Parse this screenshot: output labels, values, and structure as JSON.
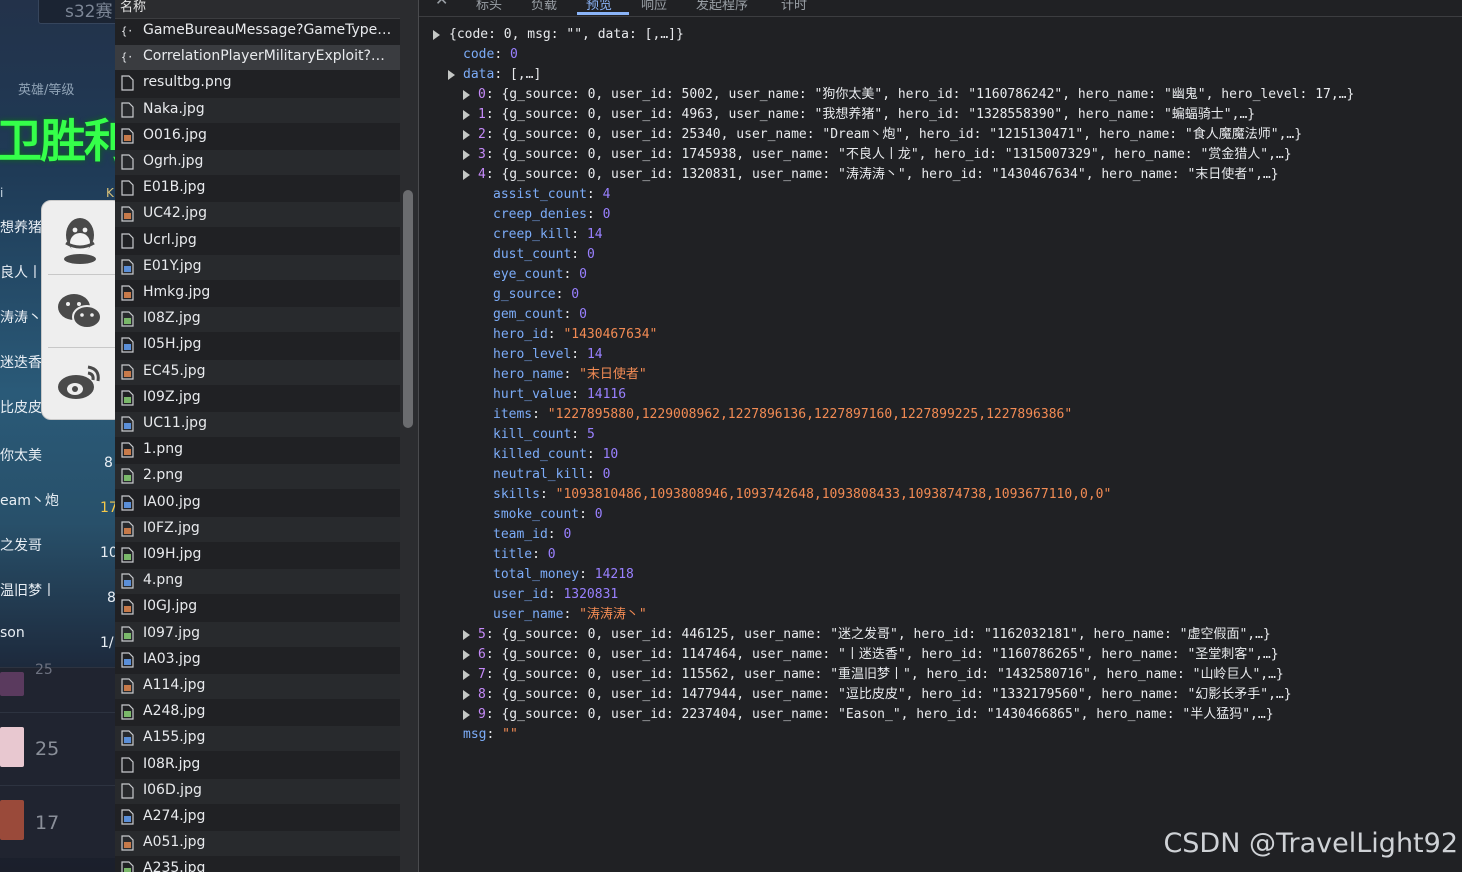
{
  "game": {
    "search_text": "s32赛",
    "header": "英雄/等级",
    "result": "卫胜利",
    "names": [
      "想养猪",
      "良人丨",
      "涛涛丶",
      "迷迭香",
      "比皮皮",
      "你太美",
      "eam丶炮",
      "之发哥",
      "温旧梦丨",
      "son"
    ],
    "numbers": [
      "8",
      "17",
      "10",
      "8",
      "1/"
    ],
    "levels": [
      "25",
      "17"
    ],
    "col_marks": [
      "i",
      "K"
    ]
  },
  "share_icons": [
    "qq-icon",
    "wechat-icon",
    "weibo-icon"
  ],
  "files": {
    "column_header": "名称",
    "items": [
      {
        "name": "GameBureauMessage?GameTypeID...",
        "type": "xhr"
      },
      {
        "name": "CorrelationPlayerMilitaryExploit?Ga...",
        "type": "xhr",
        "selected": true
      },
      {
        "name": "resultbg.png",
        "type": "doc"
      },
      {
        "name": "Naka.jpg",
        "type": "doc"
      },
      {
        "name": "O016.jpg",
        "type": "img"
      },
      {
        "name": "Ogrh.jpg",
        "type": "doc"
      },
      {
        "name": "E01B.jpg",
        "type": "doc"
      },
      {
        "name": "UC42.jpg",
        "type": "img"
      },
      {
        "name": "Ucrl.jpg",
        "type": "doc"
      },
      {
        "name": "E01Y.jpg",
        "type": "img"
      },
      {
        "name": "Hmkg.jpg",
        "type": "img"
      },
      {
        "name": "I08Z.jpg",
        "type": "img"
      },
      {
        "name": "I05H.jpg",
        "type": "img"
      },
      {
        "name": "EC45.jpg",
        "type": "img"
      },
      {
        "name": "I09Z.jpg",
        "type": "img"
      },
      {
        "name": "UC11.jpg",
        "type": "img"
      },
      {
        "name": "1.png",
        "type": "img"
      },
      {
        "name": "2.png",
        "type": "img"
      },
      {
        "name": "IA00.jpg",
        "type": "img"
      },
      {
        "name": "I0FZ.jpg",
        "type": "img"
      },
      {
        "name": "I09H.jpg",
        "type": "img"
      },
      {
        "name": "4.png",
        "type": "img"
      },
      {
        "name": "I0GJ.jpg",
        "type": "img"
      },
      {
        "name": "I097.jpg",
        "type": "img"
      },
      {
        "name": "IA03.jpg",
        "type": "img"
      },
      {
        "name": "A114.jpg",
        "type": "img"
      },
      {
        "name": "A248.jpg",
        "type": "img"
      },
      {
        "name": "A155.jpg",
        "type": "img"
      },
      {
        "name": "I08R.jpg",
        "type": "doc"
      },
      {
        "name": "I06D.jpg",
        "type": "doc"
      },
      {
        "name": "A274.jpg",
        "type": "img"
      },
      {
        "name": "A051.jpg",
        "type": "img"
      },
      {
        "name": "A235.jpg",
        "type": "img"
      }
    ]
  },
  "tabs": [
    {
      "label": "标头"
    },
    {
      "label": "负载"
    },
    {
      "label": "预览",
      "active": true
    },
    {
      "label": "响应"
    },
    {
      "label": "发起程序"
    },
    {
      "label": "计时"
    }
  ],
  "preview": {
    "root": "{code: 0, msg: \"\", data: [,…]}",
    "code_key": "code",
    "code_val": "0",
    "data_key": "data",
    "data_summary": "[,…]",
    "collapsed_before": [
      {
        "idx": "0",
        "summary": "{g_source: 0, user_id: 5002, user_name: \"狗你太美\", hero_id: \"1160786242\", hero_name: \"幽鬼\", hero_level: 17,…}"
      },
      {
        "idx": "1",
        "summary": "{g_source: 0, user_id: 4963, user_name: \"我想养猪\", hero_id: \"1328558390\", hero_name: \"蝙蝠骑士\",…}"
      },
      {
        "idx": "2",
        "summary": "{g_source: 0, user_id: 25340, user_name: \"Dream丶炮\", hero_id: \"1215130471\", hero_name: \"食人魔魔法师\",…}"
      },
      {
        "idx": "3",
        "summary": "{g_source: 0, user_id: 1745938, user_name: \"不良人丨龙\", hero_id: \"1315007329\", hero_name: \"赏金猎人\",…}"
      },
      {
        "idx": "4",
        "summary": "{g_source: 0, user_id: 1320831, user_name: \"涛涛涛丶\", hero_id: \"1430467634\", hero_name: \"末日使者\",…}"
      }
    ],
    "expanded": [
      {
        "key": "assist_count",
        "val": "4",
        "kind": "n"
      },
      {
        "key": "creep_denies",
        "val": "0",
        "kind": "n"
      },
      {
        "key": "creep_kill",
        "val": "14",
        "kind": "n"
      },
      {
        "key": "dust_count",
        "val": "0",
        "kind": "n"
      },
      {
        "key": "eye_count",
        "val": "0",
        "kind": "n"
      },
      {
        "key": "g_source",
        "val": "0",
        "kind": "n"
      },
      {
        "key": "gem_count",
        "val": "0",
        "kind": "n"
      },
      {
        "key": "hero_id",
        "val": "\"1430467634\"",
        "kind": "s"
      },
      {
        "key": "hero_level",
        "val": "14",
        "kind": "n"
      },
      {
        "key": "hero_name",
        "val": "\"末日使者\"",
        "kind": "s"
      },
      {
        "key": "hurt_value",
        "val": "14116",
        "kind": "n"
      },
      {
        "key": "items",
        "val": "\"1227895880,1229008962,1227896136,1227897160,1227899225,1227896386\"",
        "kind": "s"
      },
      {
        "key": "kill_count",
        "val": "5",
        "kind": "n"
      },
      {
        "key": "killed_count",
        "val": "10",
        "kind": "n"
      },
      {
        "key": "neutral_kill",
        "val": "0",
        "kind": "n"
      },
      {
        "key": "skills",
        "val": "\"1093810486,1093808946,1093742648,1093808433,1093874738,1093677110,0,0\"",
        "kind": "s"
      },
      {
        "key": "smoke_count",
        "val": "0",
        "kind": "n"
      },
      {
        "key": "team_id",
        "val": "0",
        "kind": "n"
      },
      {
        "key": "title",
        "val": "0",
        "kind": "n"
      },
      {
        "key": "total_money",
        "val": "14218",
        "kind": "n"
      },
      {
        "key": "user_id",
        "val": "1320831",
        "kind": "n"
      },
      {
        "key": "user_name",
        "val": "\"涛涛涛丶\"",
        "kind": "s"
      }
    ],
    "collapsed_after": [
      {
        "idx": "5",
        "summary": "{g_source: 0, user_id: 446125, user_name: \"迷之发哥\", hero_id: \"1162032181\", hero_name: \"虚空假面\",…}"
      },
      {
        "idx": "6",
        "summary": "{g_source: 0, user_id: 1147464, user_name: \"丨迷迭香\", hero_id: \"1160786265\", hero_name: \"圣堂刺客\",…}"
      },
      {
        "idx": "7",
        "summary": "{g_source: 0, user_id: 115562, user_name: \"重温旧梦丨\", hero_id: \"1432580716\", hero_name: \"山岭巨人\",…}"
      },
      {
        "idx": "8",
        "summary": "{g_source: 0, user_id: 1477944, user_name: \"逗比皮皮\", hero_id: \"1332179560\", hero_name: \"幻影长矛手\",…}"
      },
      {
        "idx": "9",
        "summary": "{g_source: 0, user_id: 2237404, user_name: \"Eason_\", hero_id: \"1430466865\", hero_name: \"半人猛犸\",…}"
      }
    ],
    "msg_key": "msg",
    "msg_val": "\"\""
  },
  "watermark": "CSDN @TravelLight92"
}
